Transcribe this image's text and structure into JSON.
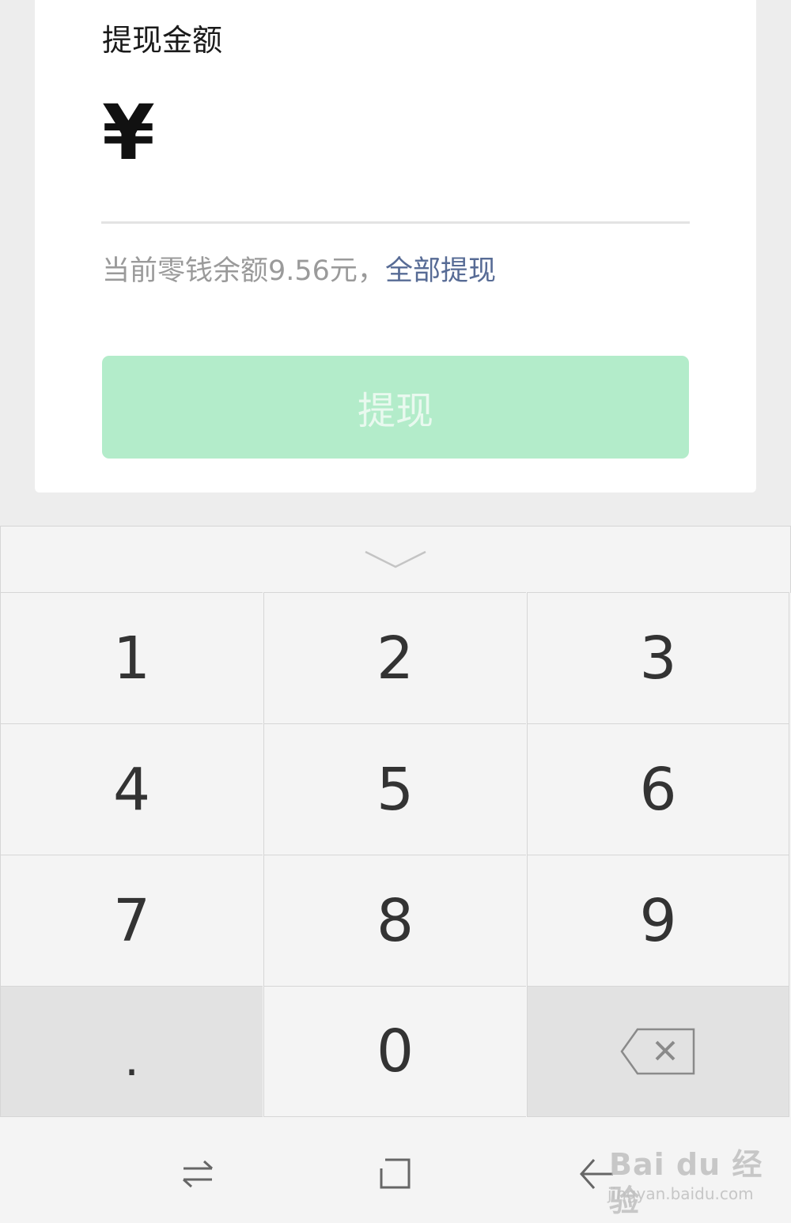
{
  "withdraw_card": {
    "title": "提现金额",
    "currency_symbol": "¥",
    "amount_value": "",
    "balance_text": "当前零钱余额9.56元，",
    "withdraw_all_label": "全部提现",
    "submit_label": "提现",
    "submit_color": "#b3ecca",
    "link_color": "#576b95"
  },
  "keyboard": {
    "collapse_icon": "chevron-down-icon",
    "keys": [
      "1",
      "2",
      "3",
      "4",
      "5",
      "6",
      "7",
      "8",
      "9",
      ".",
      "0"
    ],
    "backspace_icon": "backspace-icon"
  },
  "navbar": {
    "icons": [
      "switch-icon",
      "home-icon",
      "back-icon"
    ]
  },
  "watermark": {
    "main": "Bai du 经验",
    "sub": "jingyan.baidu.com"
  }
}
